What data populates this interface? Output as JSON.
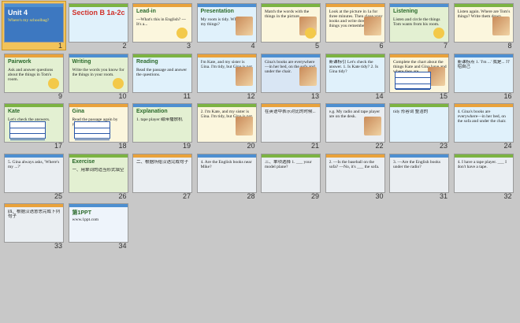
{
  "slides": [
    {
      "n": "1",
      "title": "Unit 4",
      "sub": "Where's my schoolbag?"
    },
    {
      "n": "2",
      "title": "Section B 1a-2c"
    },
    {
      "n": "3",
      "title": "Lead-in",
      "caption": "---What's this in English? ---It's a..."
    },
    {
      "n": "4",
      "title": "Presentation",
      "caption": "My room is tidy. Where are my things?"
    },
    {
      "n": "5",
      "caption": "Match the words with the things in the picture."
    },
    {
      "n": "6",
      "caption": "Look at the picture in 1a for three minutes. Then close your books and write down all the things you remember."
    },
    {
      "n": "7",
      "title": "Listening",
      "caption": "Listen and circle the things Tom wants from his room."
    },
    {
      "n": "8",
      "caption": "Listen again. Where are Tom's things? Write them down."
    },
    {
      "n": "9",
      "title": "Pairwork",
      "caption": "Ask and answer questions about the things in Tom's room."
    },
    {
      "n": "10",
      "title": "Writing",
      "caption": "Write the words you know for the things in your room."
    },
    {
      "n": "11",
      "title": "Reading",
      "caption": "Read the passage and answer the questions."
    },
    {
      "n": "12",
      "caption": "I'm Kate, and my sister is Gina. I'm tidy, but Gina is not."
    },
    {
      "n": "13",
      "caption": "Gina's books are everywhere—in her bed, on the sofa and under the chair."
    },
    {
      "n": "14",
      "caption": "新课标引 Let's check the answer. 1. Is Kate tidy? 2. Is Gina tidy?"
    },
    {
      "n": "15",
      "caption": "Complete the chart about the things Kate and Gina have and where they are."
    },
    {
      "n": "16",
      "caption": "新课标点 1. 'I'm ...' 我是... 介绍自己"
    },
    {
      "n": "17",
      "title": "Kate",
      "caption": "Let's check the answers."
    },
    {
      "n": "18",
      "title": "Gina",
      "caption": "Read the passage again by yourself."
    },
    {
      "n": "19",
      "title": "Explanation",
      "caption": "1. tape player 磁带播放机"
    },
    {
      "n": "20",
      "caption": "2. I'm Kate, and my sister is Gina. I'm tidy, but Gina is not."
    },
    {
      "n": "21",
      "caption": "在英语中表示对比的时候..."
    },
    {
      "n": "22",
      "caption": "e.g. My radio and tape player are on the desk."
    },
    {
      "n": "23",
      "caption": "tidy 形容词 整洁的"
    },
    {
      "n": "24",
      "caption": "4. Gina's books are everywhere—in her bed, on the sofa and under the chair."
    },
    {
      "n": "25",
      "caption": "5. Gina always asks, 'Where's my ...?'"
    },
    {
      "n": "26",
      "title": "Exercise",
      "caption": "一、用单词的适当形式填空"
    },
    {
      "n": "27",
      "caption": "二、根据所给汉语完成句子"
    },
    {
      "n": "28",
      "caption": "4. Are the English books near Mike?"
    },
    {
      "n": "29",
      "caption": "三、单项选择 1. ___ your model plane?"
    },
    {
      "n": "30",
      "caption": "2. —Is the baseball on the sofa? —No, it's ___ the sofa."
    },
    {
      "n": "31",
      "caption": "3. —Are the English books under the radio?"
    },
    {
      "n": "32",
      "caption": "4. I have a tape player. ___ I don't have a tape."
    },
    {
      "n": "33",
      "caption": "四、根据汉语意思完成下列句子"
    },
    {
      "n": "34",
      "title": "第1PPT",
      "caption": "www.1ppt.com"
    }
  ]
}
